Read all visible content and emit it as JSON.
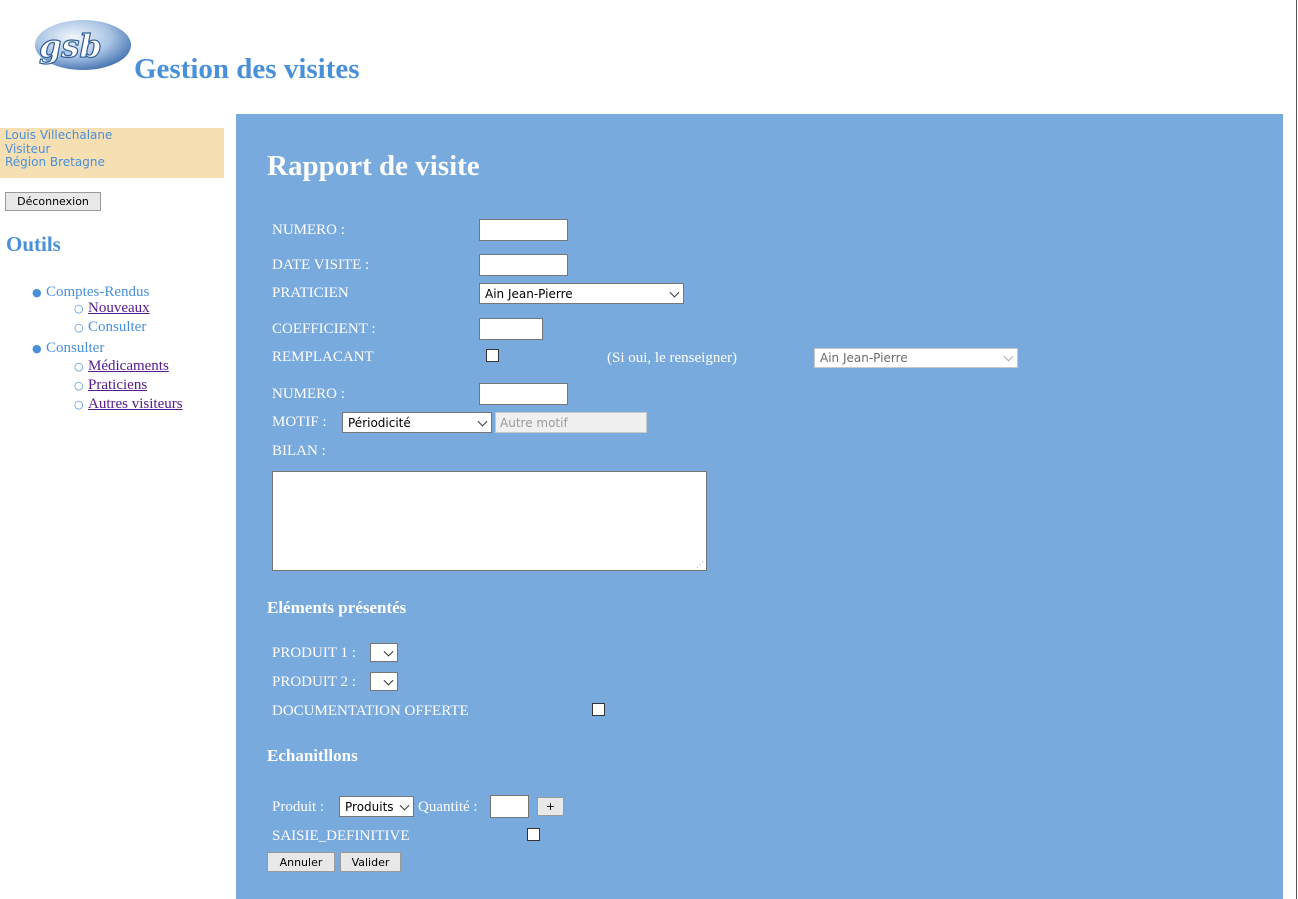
{
  "header": {
    "title": "Gestion des visites",
    "logo_icon": "gsb-logo"
  },
  "user": {
    "name": "Louis Villechalane",
    "role": "Visiteur",
    "region": "Région Bretagne"
  },
  "sidebar": {
    "logout_label": "Déconnexion",
    "tools_title": "Outils",
    "groups": [
      {
        "label": "Comptes-Rendus",
        "items": [
          {
            "label": "Nouveaux"
          },
          {
            "label": "Consulter"
          }
        ]
      },
      {
        "label": "Consulter",
        "items": [
          {
            "label": "Médicaments"
          },
          {
            "label": "Praticiens"
          },
          {
            "label": "Autres visiteurs"
          }
        ]
      }
    ]
  },
  "form": {
    "title": "Rapport de visite",
    "numero_label": "NUMERO :",
    "date_label": "DATE VISITE :",
    "praticien_label": "PRATICIEN",
    "praticien_value": "Ain Jean-Pierre",
    "coefficient_label": "COEFFICIENT :",
    "remplacant_label": "REMPLACANT",
    "remplacant_hint": "(Si oui, le renseigner)",
    "remplacant_value": "Ain Jean-Pierre",
    "numero2_label": "NUMERO :",
    "motif_label": "MOTIF :",
    "motif_value": "Périodicité",
    "autre_motif_placeholder": "Autre motif",
    "bilan_label": "BILAN :"
  },
  "elements": {
    "title": "Eléments présentés",
    "produit1_label": "PRODUIT 1 :",
    "produit2_label": "PRODUIT 2 :",
    "documentation_label": "DOCUMENTATION OFFERTE"
  },
  "echantillons": {
    "title": "Echanitllons",
    "produit_label": "Produit :",
    "produit_value": "Produits",
    "quantite_label": "Quantité :",
    "add_label": "+",
    "saisie_label": "SAISIE_DEFINITIVE",
    "cancel_label": "Annuler",
    "submit_label": "Valider"
  },
  "colors": {
    "panel": "#78aadd",
    "accent": "#4a90d9",
    "user_box": "#f5dfb3",
    "visited_link": "#551a8b"
  }
}
